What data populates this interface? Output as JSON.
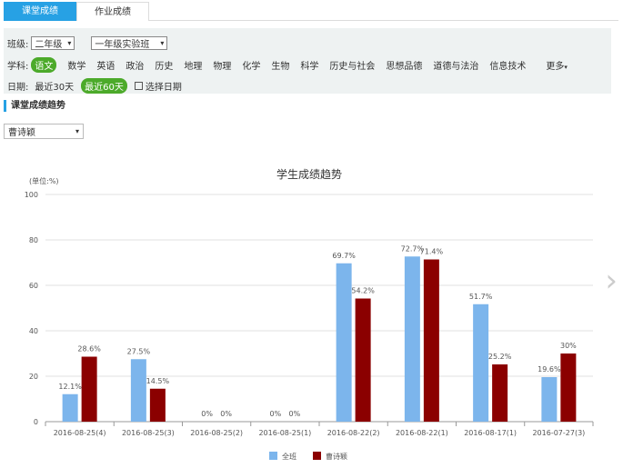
{
  "tabs": [
    {
      "label": "课堂成绩",
      "active": true
    },
    {
      "label": "作业成绩",
      "active": false
    }
  ],
  "filters": {
    "class_label": "班级:",
    "grade_value": "二年级",
    "class_value": "一年级实验班",
    "subject_label": "学科:",
    "subjects": [
      "语文",
      "数学",
      "英语",
      "政治",
      "历史",
      "地理",
      "物理",
      "化学",
      "生物",
      "科学",
      "历史与社会",
      "思想品德",
      "道德与法治",
      "信息技术"
    ],
    "selected_subject": "语文",
    "more_label": "更多",
    "date_label": "日期:",
    "date_options": [
      "最近30天",
      "最近60天"
    ],
    "selected_date": "最近60天",
    "choose_date_label": "选择日期"
  },
  "section": {
    "title": "课堂成绩趋势"
  },
  "student_select": {
    "value": "曹诗颖"
  },
  "colors": {
    "accent": "#27a1e4",
    "green": "#4caa2a",
    "class_bar": "#7cb5ec",
    "student_bar": "#8b0000"
  },
  "chart_data": {
    "type": "bar",
    "title": "学生成绩趋势",
    "unit_label": "(单位:%)",
    "categories": [
      "2016-08-25(4)",
      "2016-08-25(3)",
      "2016-08-25(2)",
      "2016-08-25(1)",
      "2016-08-22(2)",
      "2016-08-22(1)",
      "2016-08-17(1)",
      "2016-07-27(3)"
    ],
    "series": [
      {
        "name": "全班",
        "color": "#7cb5ec",
        "values": [
          12.1,
          27.5,
          0,
          0,
          69.7,
          72.7,
          51.7,
          19.6
        ],
        "labels": [
          "12.1%",
          "27.5%",
          "0%",
          "0%",
          "69.7%",
          "72.7%",
          "51.7%",
          "19.6%"
        ]
      },
      {
        "name": "曹诗颖",
        "color": "#8b0000",
        "values": [
          28.6,
          14.5,
          0,
          0,
          54.2,
          71.4,
          25.2,
          30
        ],
        "labels": [
          "28.6%",
          "14.5%",
          "0%",
          "0%",
          "54.2%",
          "71.4%",
          "25.2%",
          "30%"
        ]
      }
    ],
    "ylim": [
      0,
      100
    ],
    "yticks": [
      0,
      20,
      40,
      60,
      80,
      100
    ],
    "grid": true,
    "legend": "bottom"
  }
}
